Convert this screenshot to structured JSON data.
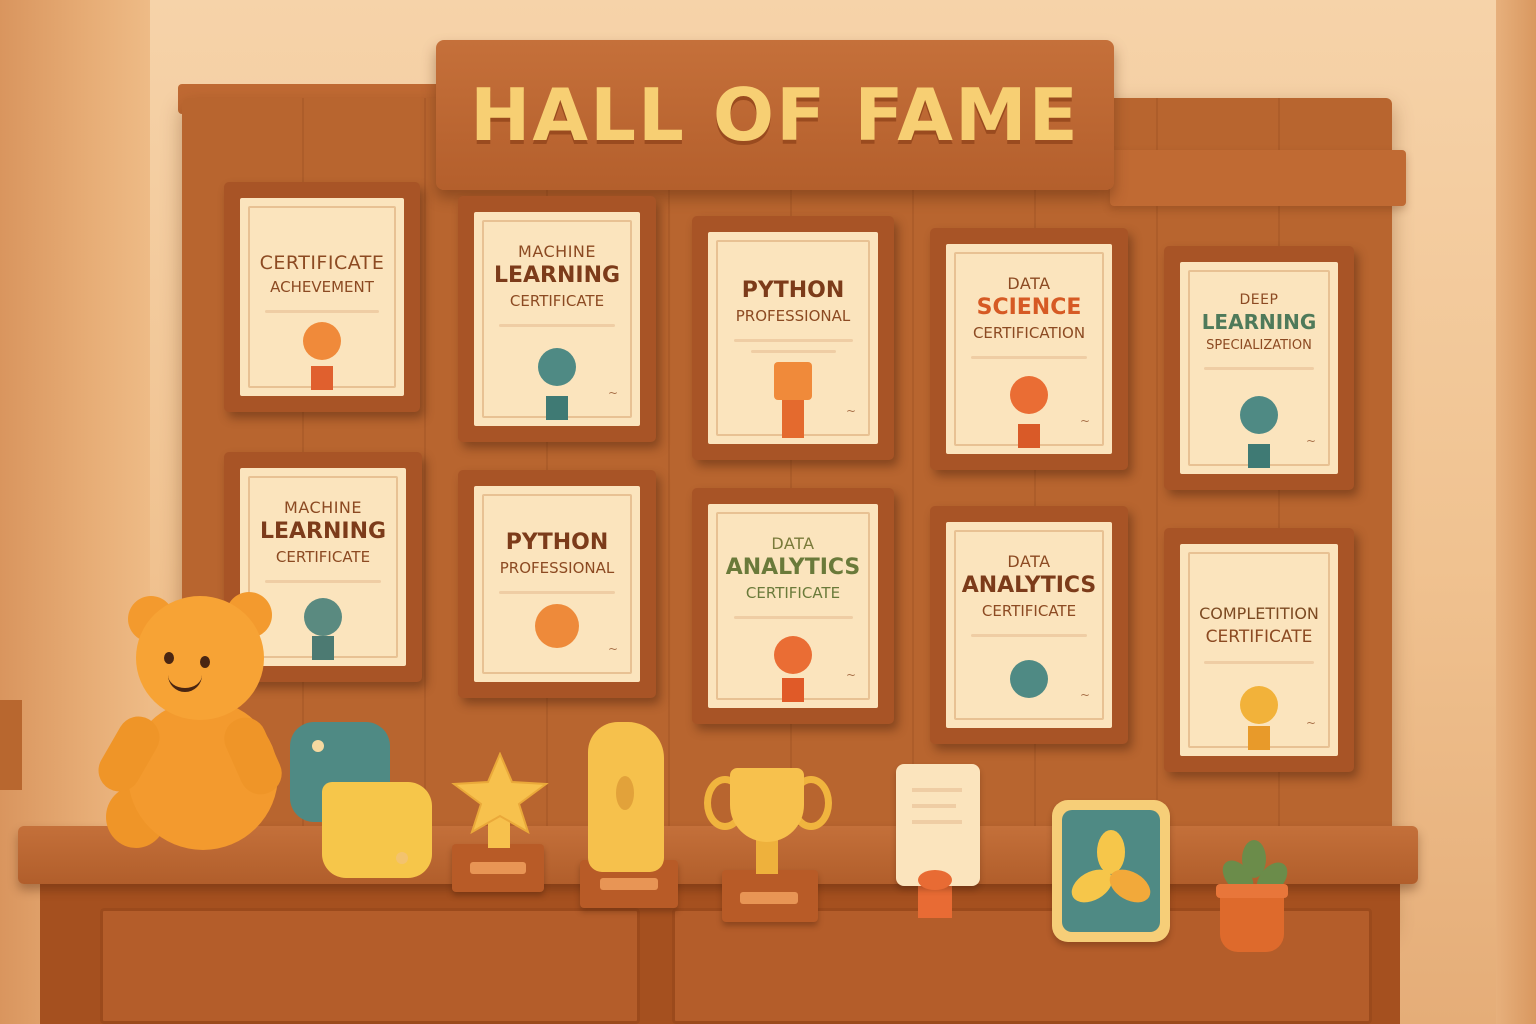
{
  "sign": {
    "title": "HALL OF FAME"
  },
  "certificates": [
    {
      "line1": "CERTIFICATE",
      "line2": "",
      "line3": "ACHEVEMENT",
      "seal_color": "#f08a3a",
      "ribbon_color": "#e0602e"
    },
    {
      "line1": "MACHINE",
      "line2": "LEARNING",
      "line3": "CERTIFICATE",
      "seal_color": "#4f8a84",
      "ribbon_color": "#3f7a74"
    },
    {
      "line1": "",
      "line2": "PYTHON",
      "line3": "PROFESSIONAL",
      "seal_color": "#f08a3a",
      "ribbon_color": "#e46a2e"
    },
    {
      "line1": "DATA",
      "line2": "SCIENCE",
      "line3": "CERTIFICATION",
      "seal_color": "#ea6d34",
      "ribbon_color": "#d95a28"
    },
    {
      "line1": "DEEP",
      "line2": "LEARNING",
      "line3": "SPECIALIZATION",
      "seal_color": "#4f8a84",
      "ribbon_color": "#3f7a74"
    },
    {
      "line1": "MACHINE",
      "line2": "LEARNING",
      "line3": "CERTIFICATE",
      "seal_color": "#5a8a80",
      "ribbon_color": "#4c7a72"
    },
    {
      "line1": "",
      "line2": "PYTHON",
      "line3": "PROFESSIONAL",
      "seal_color": "#ee8a3a",
      "ribbon_color": "#ee8a3a"
    },
    {
      "line1": "DATA",
      "line2": "ANALYTICS",
      "line3": "CERTIFICATE",
      "seal_color": "#ea6d34",
      "ribbon_color": "#e05a28"
    },
    {
      "line1": "DATA",
      "line2": "ANALYTICS",
      "line3": "CERTIFICATE",
      "seal_color": "#4f8a84",
      "ribbon_color": "#4f8a84"
    },
    {
      "line1": "",
      "line2": "COMPLETITION",
      "line3": "CERTIFICATE",
      "seal_color": "#f2b23a",
      "ribbon_color": "#e89a2a"
    }
  ],
  "colors": {
    "wood": "#b8652f",
    "gold": "#f7c14d",
    "teal": "#4f8a84",
    "orange": "#f39a2e"
  }
}
